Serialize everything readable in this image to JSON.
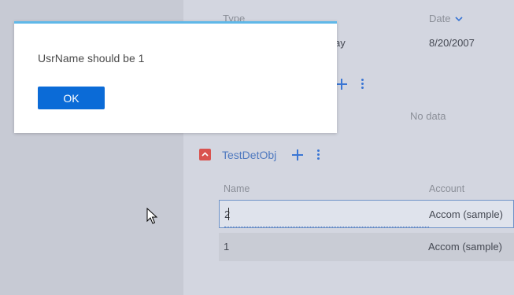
{
  "grid": {
    "columns": {
      "type": "Type",
      "date": "Date"
    },
    "rows": [
      {
        "type_partial": "ay",
        "date": "8/20/2007"
      }
    ],
    "no_data": "No data"
  },
  "detail": {
    "title": "TestDetObj",
    "columns": {
      "name": "Name",
      "account": "Account"
    },
    "rows": [
      {
        "name": "2",
        "account": "Accom (sample)",
        "state": "editing"
      },
      {
        "name": "1",
        "account": "Accom (sample)",
        "state": "normal"
      }
    ]
  },
  "modal": {
    "message": "UsrName should be 1",
    "ok_label": "OK"
  },
  "colors": {
    "accent": "#0b6bd7",
    "link_blue": "#4f79bf",
    "toggle_red": "#d9534f",
    "modal_top_bar": "#5fb8e8"
  },
  "icons": {
    "sort": "chevron-down-icon",
    "add": "plus-icon",
    "menu": "more-vertical-icon",
    "collapse": "chevron-up-icon",
    "pointer": "mouse-cursor-icon"
  }
}
